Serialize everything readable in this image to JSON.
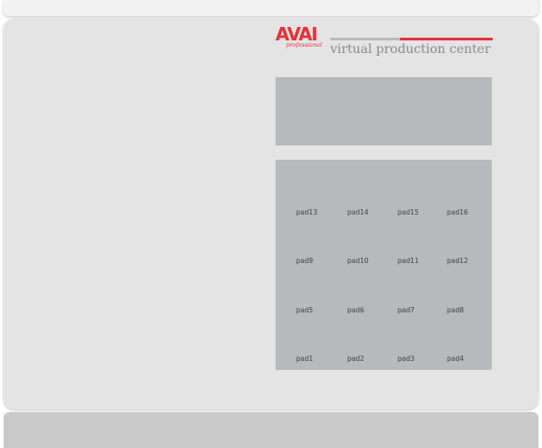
{
  "brand": {
    "logo_text": "AVAI",
    "logo_subtext": "professional",
    "tagline": "virtual production center",
    "accent_color": "#e8303a"
  },
  "pads": [
    {
      "label": "pad13"
    },
    {
      "label": "pad14"
    },
    {
      "label": "pad15"
    },
    {
      "label": "pad16"
    },
    {
      "label": "pad9"
    },
    {
      "label": "pad10"
    },
    {
      "label": "pad11"
    },
    {
      "label": "pad12"
    },
    {
      "label": "pad5"
    },
    {
      "label": "pad6"
    },
    {
      "label": "pad7"
    },
    {
      "label": "pad8"
    },
    {
      "label": "pad1"
    },
    {
      "label": "pad2"
    },
    {
      "label": "pad3"
    },
    {
      "label": "pad4"
    }
  ]
}
